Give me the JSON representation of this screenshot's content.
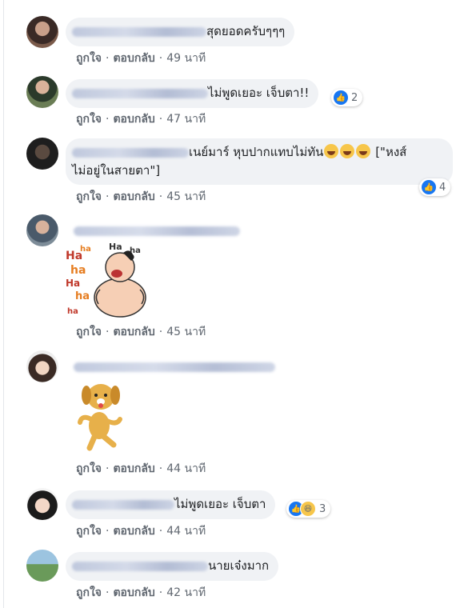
{
  "actions": {
    "like": "ถูกใจ",
    "reply": "ตอบกลับ",
    "sep": "·"
  },
  "comments": [
    {
      "text": "สุดยอดครับๆๆๆ",
      "time": "49 นาที"
    },
    {
      "text": "ไม่พูดเยอะ เจ็บตา!!",
      "time": "47 นาที",
      "reactions": {
        "icons": [
          "like-icon"
        ],
        "count": "2"
      }
    },
    {
      "text_line1": "เนย์มาร์ หุบปากแทบไม่ทัน",
      "text_line1_after": "[\"หงส์",
      "text_line2": "ไม่อยู่ในสายตา\"]",
      "emojis": [
        "laughing-emoji",
        "laughing-emoji",
        "laughing-emoji"
      ],
      "time": "45 นาที",
      "reactions": {
        "icons": [
          "like-icon"
        ],
        "count": "4"
      }
    },
    {
      "sticker": "haha-laughing-man-sticker",
      "sticker_text": [
        "Ha",
        "ha",
        "ha",
        "Ha",
        "ha",
        "ha",
        "Ha",
        "ha"
      ],
      "time": "45 นาที"
    },
    {
      "sticker": "dancing-dog-sticker",
      "time": "44 นาที"
    },
    {
      "text": "ไม่พูดเยอะ เจ็บตา",
      "time": "44 นาที",
      "reactions": {
        "icons": [
          "like-icon",
          "haha-icon"
        ],
        "count": "3"
      }
    },
    {
      "text": "นายเจ๋งมาก",
      "time": "42 นาที"
    }
  ],
  "colors": {
    "bubble": "#f0f2f5",
    "link": "#606770",
    "like_blue": "#1877f2"
  }
}
